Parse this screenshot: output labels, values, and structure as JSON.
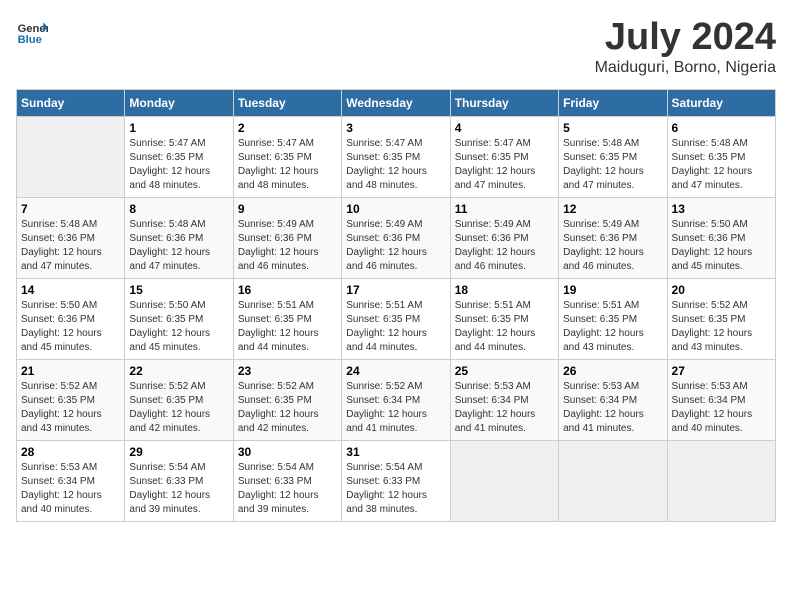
{
  "logo": {
    "text_general": "General",
    "text_blue": "Blue"
  },
  "title": "July 2024",
  "subtitle": "Maiduguri, Borno, Nigeria",
  "days_of_week": [
    "Sunday",
    "Monday",
    "Tuesday",
    "Wednesday",
    "Thursday",
    "Friday",
    "Saturday"
  ],
  "weeks": [
    [
      {
        "day": "",
        "info": ""
      },
      {
        "day": "1",
        "info": "Sunrise: 5:47 AM\nSunset: 6:35 PM\nDaylight: 12 hours\nand 48 minutes."
      },
      {
        "day": "2",
        "info": "Sunrise: 5:47 AM\nSunset: 6:35 PM\nDaylight: 12 hours\nand 48 minutes."
      },
      {
        "day": "3",
        "info": "Sunrise: 5:47 AM\nSunset: 6:35 PM\nDaylight: 12 hours\nand 48 minutes."
      },
      {
        "day": "4",
        "info": "Sunrise: 5:47 AM\nSunset: 6:35 PM\nDaylight: 12 hours\nand 47 minutes."
      },
      {
        "day": "5",
        "info": "Sunrise: 5:48 AM\nSunset: 6:35 PM\nDaylight: 12 hours\nand 47 minutes."
      },
      {
        "day": "6",
        "info": "Sunrise: 5:48 AM\nSunset: 6:35 PM\nDaylight: 12 hours\nand 47 minutes."
      }
    ],
    [
      {
        "day": "7",
        "info": "Sunrise: 5:48 AM\nSunset: 6:36 PM\nDaylight: 12 hours\nand 47 minutes."
      },
      {
        "day": "8",
        "info": "Sunrise: 5:48 AM\nSunset: 6:36 PM\nDaylight: 12 hours\nand 47 minutes."
      },
      {
        "day": "9",
        "info": "Sunrise: 5:49 AM\nSunset: 6:36 PM\nDaylight: 12 hours\nand 46 minutes."
      },
      {
        "day": "10",
        "info": "Sunrise: 5:49 AM\nSunset: 6:36 PM\nDaylight: 12 hours\nand 46 minutes."
      },
      {
        "day": "11",
        "info": "Sunrise: 5:49 AM\nSunset: 6:36 PM\nDaylight: 12 hours\nand 46 minutes."
      },
      {
        "day": "12",
        "info": "Sunrise: 5:49 AM\nSunset: 6:36 PM\nDaylight: 12 hours\nand 46 minutes."
      },
      {
        "day": "13",
        "info": "Sunrise: 5:50 AM\nSunset: 6:36 PM\nDaylight: 12 hours\nand 45 minutes."
      }
    ],
    [
      {
        "day": "14",
        "info": "Sunrise: 5:50 AM\nSunset: 6:36 PM\nDaylight: 12 hours\nand 45 minutes."
      },
      {
        "day": "15",
        "info": "Sunrise: 5:50 AM\nSunset: 6:35 PM\nDaylight: 12 hours\nand 45 minutes."
      },
      {
        "day": "16",
        "info": "Sunrise: 5:51 AM\nSunset: 6:35 PM\nDaylight: 12 hours\nand 44 minutes."
      },
      {
        "day": "17",
        "info": "Sunrise: 5:51 AM\nSunset: 6:35 PM\nDaylight: 12 hours\nand 44 minutes."
      },
      {
        "day": "18",
        "info": "Sunrise: 5:51 AM\nSunset: 6:35 PM\nDaylight: 12 hours\nand 44 minutes."
      },
      {
        "day": "19",
        "info": "Sunrise: 5:51 AM\nSunset: 6:35 PM\nDaylight: 12 hours\nand 43 minutes."
      },
      {
        "day": "20",
        "info": "Sunrise: 5:52 AM\nSunset: 6:35 PM\nDaylight: 12 hours\nand 43 minutes."
      }
    ],
    [
      {
        "day": "21",
        "info": "Sunrise: 5:52 AM\nSunset: 6:35 PM\nDaylight: 12 hours\nand 43 minutes."
      },
      {
        "day": "22",
        "info": "Sunrise: 5:52 AM\nSunset: 6:35 PM\nDaylight: 12 hours\nand 42 minutes."
      },
      {
        "day": "23",
        "info": "Sunrise: 5:52 AM\nSunset: 6:35 PM\nDaylight: 12 hours\nand 42 minutes."
      },
      {
        "day": "24",
        "info": "Sunrise: 5:52 AM\nSunset: 6:34 PM\nDaylight: 12 hours\nand 41 minutes."
      },
      {
        "day": "25",
        "info": "Sunrise: 5:53 AM\nSunset: 6:34 PM\nDaylight: 12 hours\nand 41 minutes."
      },
      {
        "day": "26",
        "info": "Sunrise: 5:53 AM\nSunset: 6:34 PM\nDaylight: 12 hours\nand 41 minutes."
      },
      {
        "day": "27",
        "info": "Sunrise: 5:53 AM\nSunset: 6:34 PM\nDaylight: 12 hours\nand 40 minutes."
      }
    ],
    [
      {
        "day": "28",
        "info": "Sunrise: 5:53 AM\nSunset: 6:34 PM\nDaylight: 12 hours\nand 40 minutes."
      },
      {
        "day": "29",
        "info": "Sunrise: 5:54 AM\nSunset: 6:33 PM\nDaylight: 12 hours\nand 39 minutes."
      },
      {
        "day": "30",
        "info": "Sunrise: 5:54 AM\nSunset: 6:33 PM\nDaylight: 12 hours\nand 39 minutes."
      },
      {
        "day": "31",
        "info": "Sunrise: 5:54 AM\nSunset: 6:33 PM\nDaylight: 12 hours\nand 38 minutes."
      },
      {
        "day": "",
        "info": ""
      },
      {
        "day": "",
        "info": ""
      },
      {
        "day": "",
        "info": ""
      }
    ]
  ]
}
